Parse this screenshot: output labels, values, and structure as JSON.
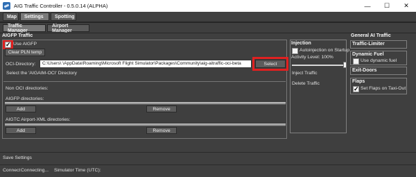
{
  "window": {
    "title": "AIG Traffic Controller - 0.5.0.14 (ALPHA)",
    "minimize_glyph": "—",
    "maximize_glyph": "☐",
    "close_glyph": "✕"
  },
  "menu_tabs": [
    "Map",
    "Settings",
    "Spotting"
  ],
  "sub_tabs": [
    "Traffic Manager",
    "Airport Manager"
  ],
  "aigfp": {
    "section_title": "AIGFP Traffic",
    "use_aigfp_label": "Use AIGFP",
    "clear_pln_label": "Clear PLN temp",
    "oci_label": "OCI-Directory:",
    "oci_value": "C:\\Users\\        \\AppData\\Roaming\\Microsoft Flight Simulator\\Packages\\Community\\aig-aitraffic-oci-beta",
    "select_button": "Select",
    "select_hint": "Select the 'AIGAIM-OCI' Directory",
    "non_oci_label": "Non OCI directories:",
    "aigfp_dirs_label": "AIGFP directories:",
    "add_label": "Add",
    "remove_label": "Remove",
    "aigtc_label": "AIGTC Airport-XML directories:",
    "add_label_2": "Add",
    "remove_label_2": "Remove"
  },
  "injection": {
    "title": "Injection",
    "autoinjection_label": "Autoinjection on Startup",
    "activity_label": "Activity Level: 100%",
    "activity_level": 1.0,
    "inject_label": "Inject Traffic",
    "delete_label": "Delete Traffic"
  },
  "general": {
    "title": "General AI Traffic",
    "traffic_limiter": "Traffic-Limiter",
    "dynamic_fuel_title": "Dynamic Fuel",
    "use_dynamic_fuel": "Use dynamic fuel",
    "exit_doors": "Exit-Doors",
    "flaps_title": "Flaps",
    "set_flaps_label": "Set Flaps on Taxi-Out"
  },
  "footer": {
    "save_settings": "Save Settings",
    "connect_label": "Connect",
    "connecting_label": "Connecting...",
    "sim_time_label": "Simulator Time (UTC):"
  }
}
